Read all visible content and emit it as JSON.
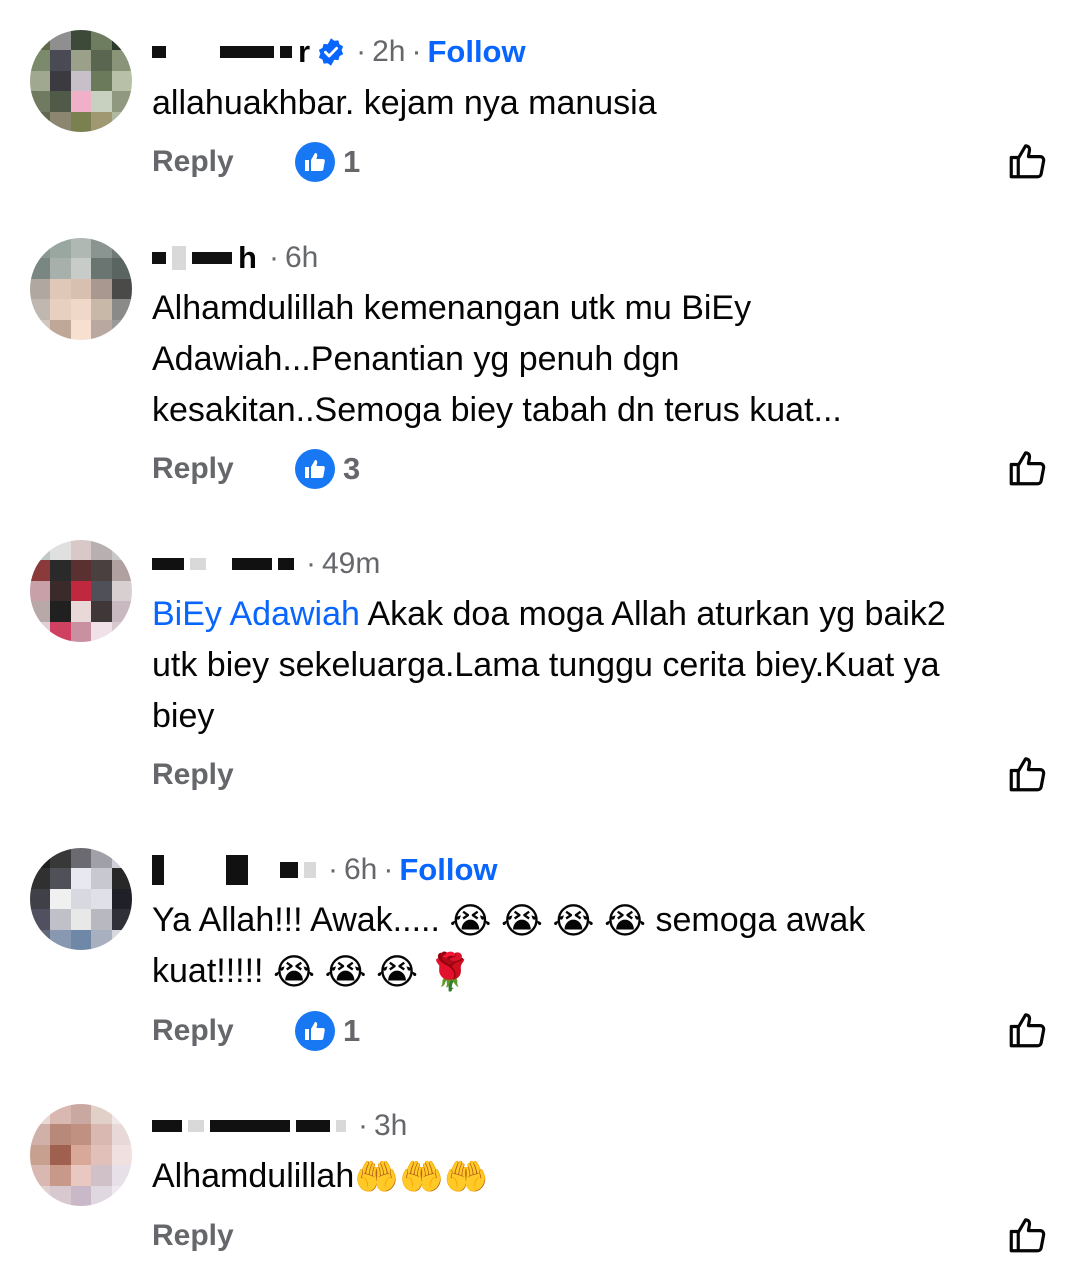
{
  "comments": [
    {
      "name_visible": "r",
      "verified": true,
      "time": "2h",
      "follow": "Follow",
      "text": "allahuakhbar. kejam nya manusia",
      "reply": "Reply",
      "likes": "1"
    },
    {
      "name_visible": "h",
      "time": "6h",
      "text": "Alhamdulillah kemenangan utk mu BiEy\nAdawiah...Penantian yg penuh dgn\nkesakitan..Semoga biey tabah dn terus kuat...",
      "reply": "Reply",
      "likes": "3"
    },
    {
      "time": "49m",
      "mention": "BiEy Adawiah",
      "text": " Akak doa moga Allah aturkan yg baik2\nutk biey sekeluarga.Lama tunggu cerita biey.Kuat ya\nbiey",
      "reply": "Reply"
    },
    {
      "time": "6h",
      "follow": "Follow",
      "text_a": "Ya Allah!!! Awak..... ",
      "text_b": " semoga awak",
      "text_c": "kuat!!!!! ",
      "emoji_cry": "😭",
      "emoji_rose": "🌹",
      "reply": "Reply",
      "likes": "1"
    },
    {
      "time": "3h",
      "text": "Alhamdulillah",
      "emoji_hands": "🤲🤲🤲",
      "reply": "Reply"
    }
  ],
  "colors": {
    "accent": "#0866ff",
    "like": "#1877f2",
    "muted": "#65676b"
  },
  "icons": [
    "verified-badge-icon",
    "like-reaction-icon",
    "thumbs-up-outline-icon"
  ]
}
